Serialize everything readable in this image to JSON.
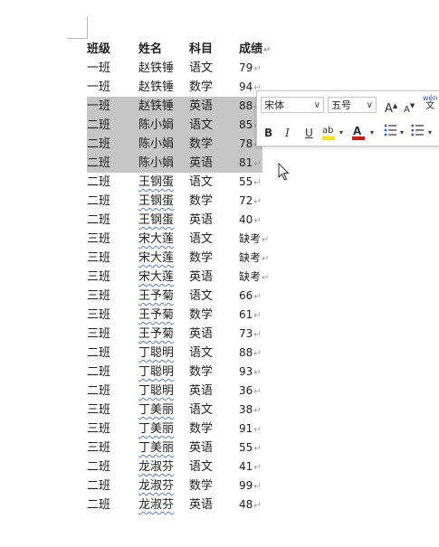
{
  "table": {
    "headers": [
      "班级",
      "姓名",
      "科目",
      "成绩"
    ],
    "rows": [
      {
        "class": "一班",
        "name": "赵铁锤",
        "subject": "语文",
        "score": "79"
      },
      {
        "class": "一班",
        "name": "赵铁锤",
        "subject": "数学",
        "score": "94"
      },
      {
        "class": "一班",
        "name": "赵铁锤",
        "subject": "英语",
        "score": "88"
      },
      {
        "class": "二班",
        "name": "陈小娟",
        "subject": "语文",
        "score": "85"
      },
      {
        "class": "二班",
        "name": "陈小娟",
        "subject": "数学",
        "score": "78"
      },
      {
        "class": "二班",
        "name": "陈小娟",
        "subject": "英语",
        "score": "81"
      },
      {
        "class": "二班",
        "name": "王钢蛋",
        "subject": "语文",
        "score": "55"
      },
      {
        "class": "二班",
        "name": "王钢蛋",
        "subject": "数学",
        "score": "72"
      },
      {
        "class": "二班",
        "name": "王钢蛋",
        "subject": "英语",
        "score": "40"
      },
      {
        "class": "三班",
        "name": "宋大莲",
        "subject": "语文",
        "score": "缺考"
      },
      {
        "class": "三班",
        "name": "宋大莲",
        "subject": "数学",
        "score": "缺考"
      },
      {
        "class": "三班",
        "name": "宋大莲",
        "subject": "英语",
        "score": "缺考"
      },
      {
        "class": "三班",
        "name": "王予菊",
        "subject": "语文",
        "score": "66"
      },
      {
        "class": "三班",
        "name": "王予菊",
        "subject": "数学",
        "score": "61"
      },
      {
        "class": "三班",
        "name": "王予菊",
        "subject": "英语",
        "score": "73"
      },
      {
        "class": "二班",
        "name": "丁聪明",
        "subject": "语文",
        "score": "88"
      },
      {
        "class": "二班",
        "name": "丁聪明",
        "subject": "数学",
        "score": "93"
      },
      {
        "class": "二班",
        "name": "丁聪明",
        "subject": "英语",
        "score": "36"
      },
      {
        "class": "三班",
        "name": "丁美丽",
        "subject": "语文",
        "score": "38"
      },
      {
        "class": "三班",
        "name": "丁美丽",
        "subject": "数学",
        "score": "91"
      },
      {
        "class": "三班",
        "name": "丁美丽",
        "subject": "英语",
        "score": "55"
      },
      {
        "class": "二班",
        "name": "龙淑芬",
        "subject": "语文",
        "score": "41"
      },
      {
        "class": "二班",
        "name": "龙淑芬",
        "subject": "数学",
        "score": "99"
      },
      {
        "class": "二班",
        "name": "龙淑芬",
        "subject": "英语",
        "score": "48"
      }
    ],
    "paragraph_mark": "↵"
  },
  "toolbar": {
    "font_name": "宋体",
    "font_size": "五号",
    "grow_label": "A",
    "shrink_label": "A",
    "phonetic_top": "wén",
    "phonetic_bottom": "文",
    "bold_label": "B",
    "italic_label": "I",
    "underline_label": "U",
    "highlight_label": "ab",
    "font_color_label": "A",
    "highlight_color": "#ffe200",
    "font_color": "#e01010",
    "icons": [
      "dropdown-chevron-icon",
      "grow-font-icon",
      "shrink-font-icon",
      "phonetic-guide-icon",
      "highlight-icon",
      "font-color-icon",
      "bullets-icon",
      "numbering-icon"
    ]
  }
}
